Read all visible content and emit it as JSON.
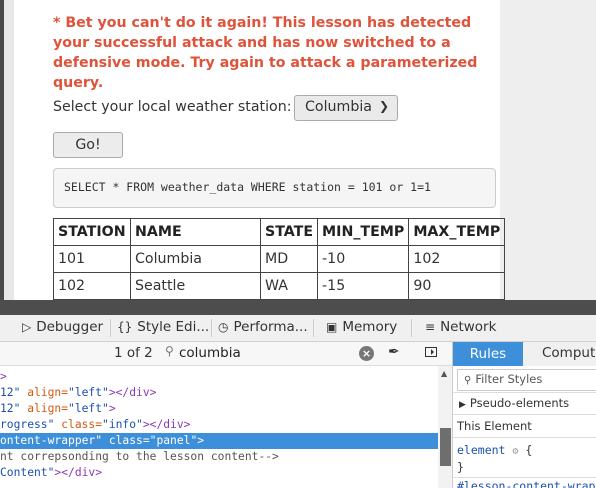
{
  "lesson": {
    "warning": "* Bet you can't do it again! This lesson has detected your successful attack and has now switched to a defensive mode. Try again to attack a parameterized query.",
    "station_label": "Select your local weather station:",
    "station_selected": "Columbia",
    "go_label": "Go!",
    "query": "SELECT * FROM weather_data WHERE station = 101 or 1=1"
  },
  "table": {
    "headers": [
      "STATION",
      "NAME",
      "STATE",
      "MIN_TEMP",
      "MAX_TEMP"
    ],
    "rows": [
      [
        "101",
        "Columbia",
        "MD",
        "-10",
        "102"
      ],
      [
        "102",
        "Seattle",
        "WA",
        "-15",
        "90"
      ]
    ]
  },
  "devtools": {
    "tabs": [
      {
        "icon": "debugger-icon",
        "label": "Debugger"
      },
      {
        "icon": "style-editor-icon",
        "label": "Style Edi..."
      },
      {
        "icon": "performance-icon",
        "label": "Performa..."
      },
      {
        "icon": "memory-icon",
        "label": "Memory"
      },
      {
        "icon": "network-icon",
        "label": "Network"
      }
    ],
    "search": {
      "count": "1 of 2",
      "value": "columbia"
    },
    "markup": {
      "l0": ">",
      "l1_a": "12\"",
      "l1_b": " align=",
      "l1_c": "\"left\"",
      "l1_d": "></div>",
      "l2_a": "12\"",
      "l2_b": " align=",
      "l2_c": "\"left\"",
      "l2_d": ">",
      "l3_a": "rogress\"",
      "l3_b": " class=",
      "l3_c": "\"info\"",
      "l3_d": "></div>",
      "l4_a": "ontent-wrapper\"",
      "l4_b": " class=",
      "l4_c": "\"panel\"",
      "l4_d": ">",
      "l5": "nt correpsonding to the lesson content-->",
      "l6_a": "Content\"",
      "l6_b": "></div>"
    },
    "sidebar": {
      "tab_rules": "Rules",
      "tab_computed": "Compute",
      "filter_placeholder": "Filter Styles",
      "pseudo": "Pseudo-elements",
      "this_element": "This Element",
      "rule_selector": "element",
      "open_brace": "{",
      "close_brace": "}",
      "next_rule": "#lesson-content-wrap"
    }
  }
}
